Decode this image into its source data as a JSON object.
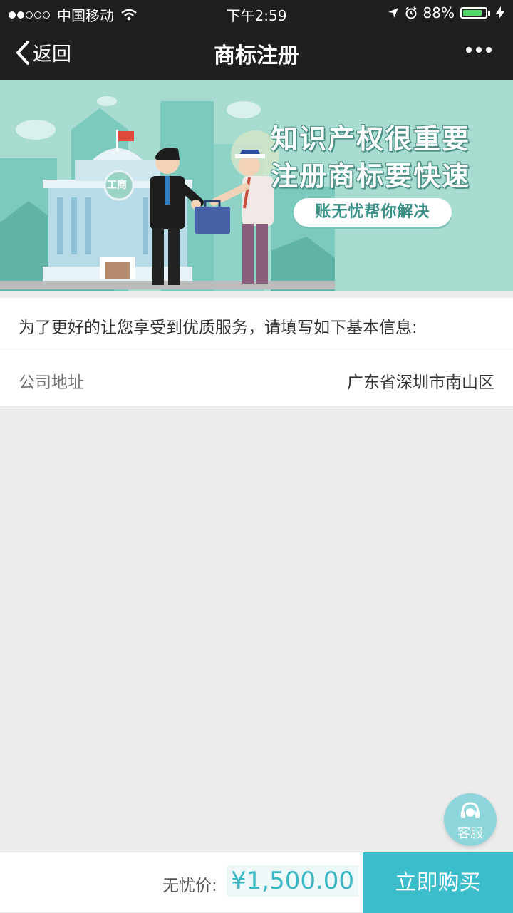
{
  "status_bar": {
    "carrier": "中国移动",
    "time": "下午2:59",
    "battery_percent": "88%",
    "battery_level": 0.88
  },
  "nav": {
    "back_label": "返回",
    "title": "商标注册"
  },
  "banner": {
    "line1": "知识产权很重要",
    "line2": "注册商标要快速",
    "pill": "账无忧帮你解决",
    "building_sign": "工商"
  },
  "form": {
    "intro": "为了更好的让您享受到优质服务，请填写如下基本信息:",
    "fields": [
      {
        "label": "公司地址",
        "value": "广东省深圳市南山区"
      }
    ]
  },
  "service": {
    "label": "客服"
  },
  "bottom": {
    "price_label": "无忧价:",
    "price": "¥1,500.00",
    "buy_label": "立即购买"
  },
  "colors": {
    "accent": "#3bbdcc",
    "banner_bg": "#a8dcd1",
    "nav_bg": "#1f1f1f",
    "battery_green": "#4cd964"
  }
}
